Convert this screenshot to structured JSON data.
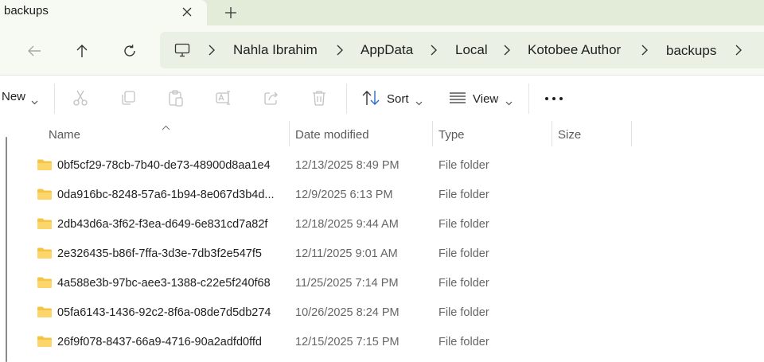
{
  "tab": {
    "title": "backups",
    "close_icon": "close-icon",
    "new_tab_icon": "plus-icon"
  },
  "nav": {
    "back_icon": "arrow-left-icon",
    "up_icon": "arrow-up-icon",
    "refresh_icon": "refresh-icon",
    "pc_icon": "computer-icon",
    "breadcrumbs": [
      "Nahla Ibrahim",
      "AppData",
      "Local",
      "Kotobee Author",
      "backups"
    ]
  },
  "commands": {
    "new_label": "New",
    "sort_label": "Sort",
    "view_label": "View",
    "icons": [
      "cut-icon",
      "copy-icon",
      "paste-icon",
      "rename-icon",
      "share-icon",
      "delete-icon"
    ]
  },
  "columns": {
    "name": "Name",
    "date": "Date modified",
    "type": "Type",
    "size": "Size"
  },
  "files": [
    {
      "name": "0bf5cf29-78cb-7b40-de73-48900d8aa1e4",
      "date": "12/13/2025 8:49 PM",
      "type": "File folder",
      "size": ""
    },
    {
      "name": "0da916bc-8248-57a6-1b94-8e067d3b4d...",
      "date": "12/9/2025 6:13 PM",
      "type": "File folder",
      "size": ""
    },
    {
      "name": "2db43d6a-3f62-f3ea-d649-6e831cd7a82f",
      "date": "12/18/2025 9:44 AM",
      "type": "File folder",
      "size": ""
    },
    {
      "name": "2e326435-b86f-7ffa-3d3e-7db3f2e547f5",
      "date": "12/11/2025 9:01 AM",
      "type": "File folder",
      "size": ""
    },
    {
      "name": "4a588e3b-97bc-aee3-1388-c22e5f240f68",
      "date": "11/25/2025 7:14 PM",
      "type": "File folder",
      "size": ""
    },
    {
      "name": "05fa6143-1436-92c2-8f6a-08de7d5db274",
      "date": "10/26/2025 8:24 PM",
      "type": "File folder",
      "size": ""
    },
    {
      "name": "26f9f078-8437-66a9-4716-90a2adfd0ffd",
      "date": "12/15/2025 7:15 PM",
      "type": "File folder",
      "size": ""
    }
  ],
  "colors": {
    "tabstrip": "#e3ecd9",
    "toolbar": "#f7f9f3",
    "address": "#ebf0e4",
    "folder": "#f4c542"
  }
}
